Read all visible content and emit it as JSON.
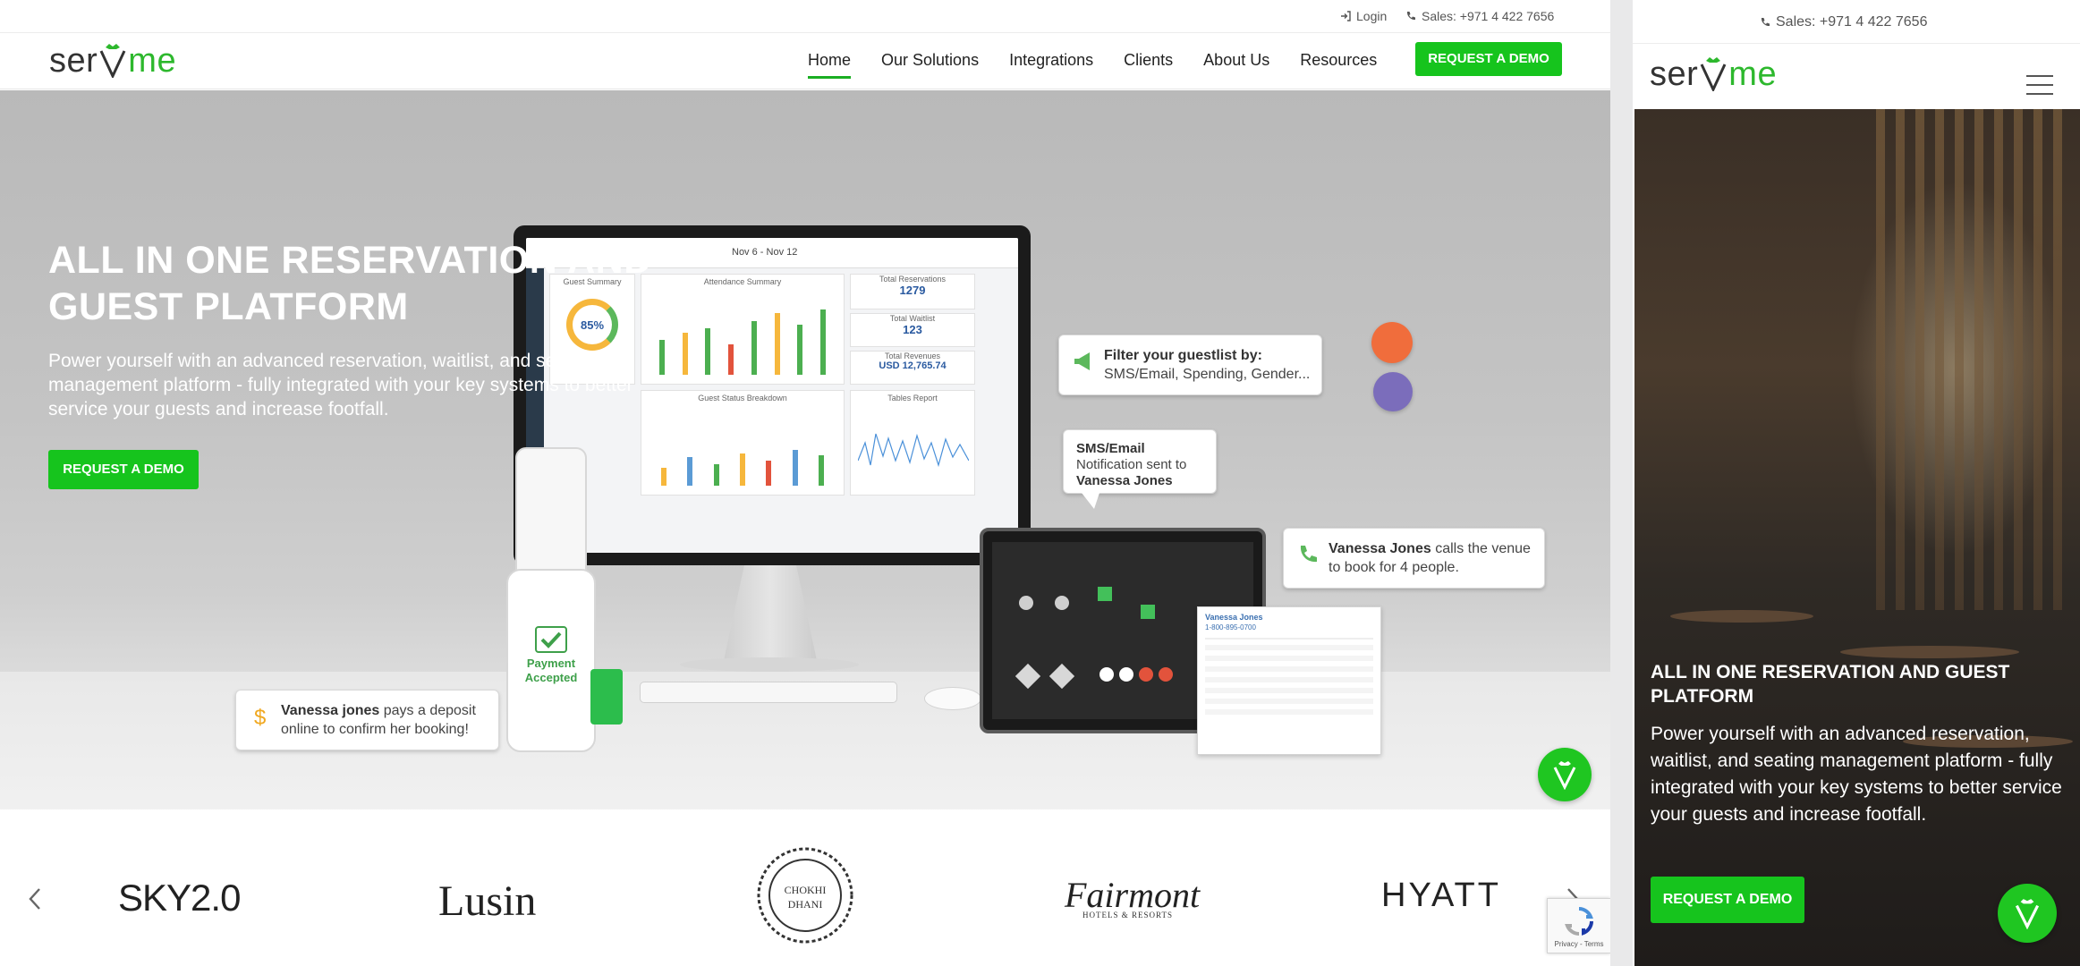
{
  "brand": {
    "name_left": "ser",
    "name_right": "me",
    "accent": "#16c41d"
  },
  "topbar": {
    "login": "Login",
    "sales": "Sales: +971 4 422 7656"
  },
  "nav": {
    "items": [
      {
        "label": "Home",
        "active": true
      },
      {
        "label": "Our Solutions",
        "active": false
      },
      {
        "label": "Integrations",
        "active": false
      },
      {
        "label": "Clients",
        "active": false
      },
      {
        "label": "About Us",
        "active": false
      },
      {
        "label": "Resources",
        "active": false
      }
    ],
    "cta": "REQUEST A DEMO"
  },
  "hero": {
    "title_line1": "ALL IN ONE RESERVATION AND",
    "title_line2": "GUEST PLATFORM",
    "text": "Power yourself with an advanced reservation, waitlist, and seating management platform - fully integrated with your key systems to better service your guests and increase footfall.",
    "cta": "REQUEST A DEMO",
    "mockup": {
      "filter_bubble_title": "Filter your guestlist by:",
      "filter_bubble_text": "SMS/Email, Spending, Gender...",
      "sms_bubble_prefix": "SMS/Email",
      "sms_bubble_mid": "Notification sent to",
      "sms_bubble_name": "Vanessa Jones",
      "call_bubble_name": "Vanessa Jones",
      "call_bubble_text": "calls the venue to book for 4 people.",
      "deposit_bubble_name": "Vanessa jones",
      "deposit_bubble_text": "pays a deposit online to confirm her booking!",
      "payment_text": "Payment Accepted",
      "dash_range": "Nov 6 - Nov 12",
      "dash_total_res_label": "Total Reservations",
      "dash_total_res": "1279",
      "dash_total_walkin_label": "Total Waitlist",
      "dash_total_walkin": "123",
      "dash_revenue_label": "Total Revenues",
      "dash_revenue": "USD 12,765.74",
      "dash_guest_summary": "Guest Summary",
      "dash_guest_pct": "85%",
      "dash_attendance": "Attendance Summary",
      "dash_status": "Guest Status Breakdown",
      "dash_tables": "Tables Report",
      "profile_name": "Vanessa Jones",
      "profile_phone": "1-800-895-0700"
    }
  },
  "clients": [
    "SKY2.0",
    "Lusin",
    "CHOKHI DHANI",
    "Fairmont",
    "HOTELS & RESORTS",
    "HYATT"
  ],
  "recaptcha": {
    "text": "Privacy - Terms"
  },
  "mobile": {
    "sales": "Sales: +971 4 422 7656",
    "title": "ALL IN ONE RESERVATION AND GUEST PLATFORM",
    "text": "Power yourself with an advanced reservation, waitlist, and seating management platform - fully integrated with your key systems to better service your guests and increase footfall.",
    "cta": "REQUEST A DEMO"
  }
}
